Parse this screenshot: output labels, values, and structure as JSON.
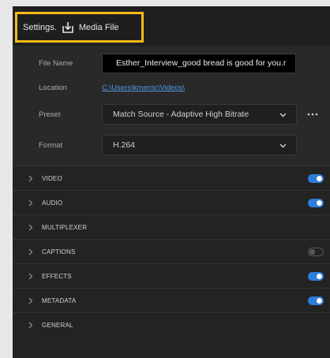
{
  "header": {
    "settings_label": "Settings.",
    "export_icon": "export-to-media-icon",
    "media_file_label": "Media File",
    "highlight_color": "#f5b917"
  },
  "form": {
    "file_name_label": "File Name",
    "file_name_value": "Esther_Interview_good bread is good for you.r",
    "location_label": "Location",
    "location_value": "C:\\Users\\kmerric\\Videos\\",
    "preset_label": "Preset",
    "preset_value": "Match Source - Adaptive High Bitrate",
    "format_label": "Format",
    "format_value": "H.264",
    "link_color": "#4d9be6"
  },
  "sections": [
    {
      "title": "VIDEO",
      "toggle": "on"
    },
    {
      "title": "AUDIO",
      "toggle": "on"
    },
    {
      "title": "MULTIPLEXER",
      "toggle": "none"
    },
    {
      "title": "CAPTIONS",
      "toggle": "off"
    },
    {
      "title": "EFFECTS",
      "toggle": "on"
    },
    {
      "title": "METADATA",
      "toggle": "on"
    },
    {
      "title": "GENERAL",
      "toggle": "none"
    }
  ],
  "toggle_on_color": "#2d7cd8"
}
